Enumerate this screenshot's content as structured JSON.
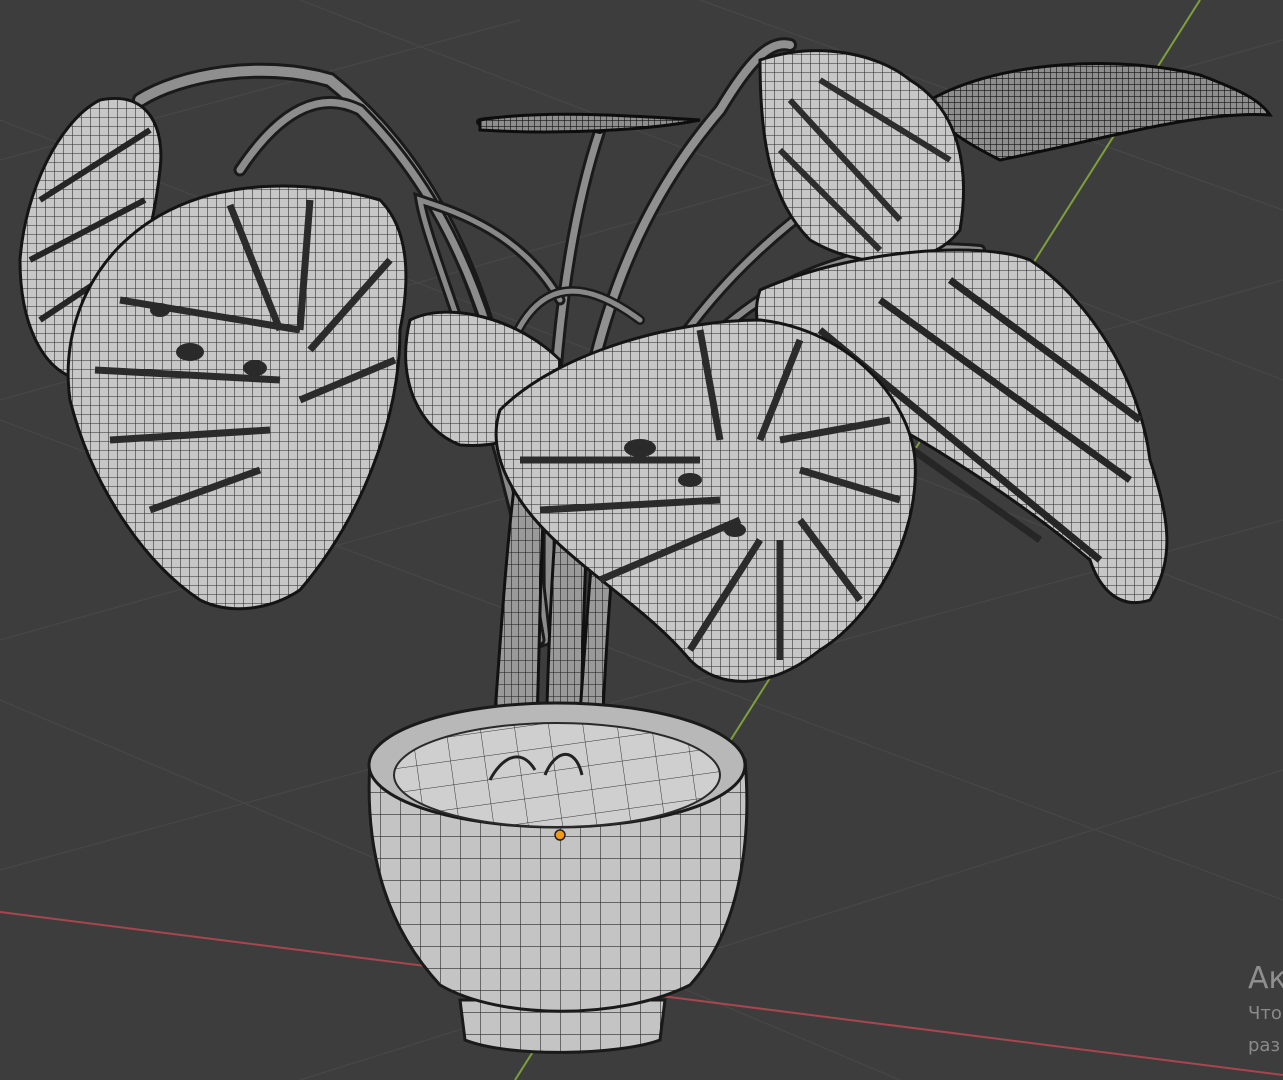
{
  "viewport": {
    "background": "#3d3d3d",
    "grid_color": "#474747",
    "x_axis_color": "#a8454f",
    "y_axis_color": "#7f9f3c",
    "mesh_fill": "#c9c9c9",
    "wire_color": "#1e1e1e",
    "origin_color": "#f29a17"
  },
  "scene": {
    "object": "monstera-plant-in-pot",
    "shading_mode": "wireframe-overlay"
  },
  "activation_watermark": {
    "title": "Ак",
    "line1": "Что",
    "line2": "раз"
  }
}
